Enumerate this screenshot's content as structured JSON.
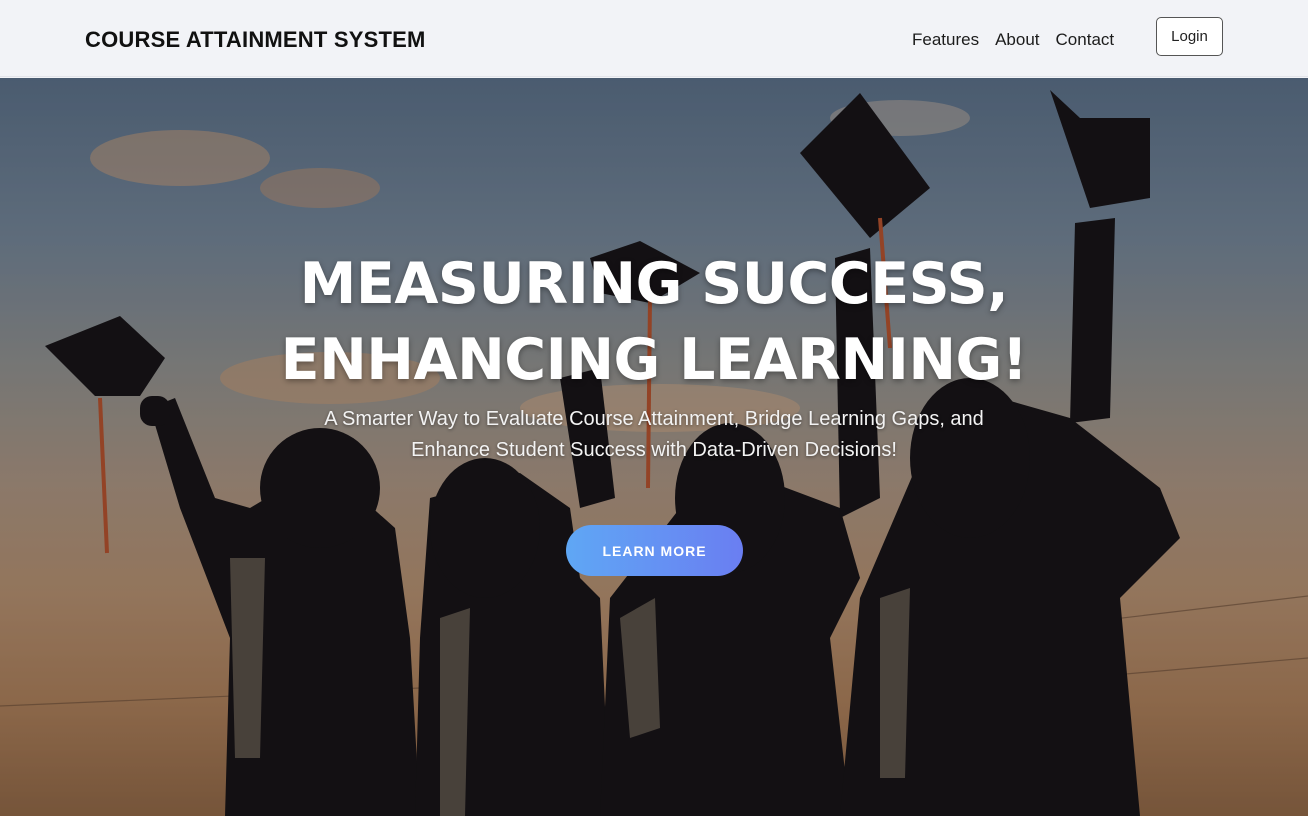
{
  "navbar": {
    "brand": "COURSE ATTAINMENT SYSTEM",
    "links": [
      "Features",
      "About",
      "Contact"
    ],
    "login_label": "Login"
  },
  "hero": {
    "headline_line1": "MEASURING SUCCESS,",
    "headline_line2": "ENHANCING LEARNING!",
    "subtext_line1": "A Smarter Way to Evaluate Course Attainment, Bridge Learning Gaps, and",
    "subtext_line2": "Enhance Student Success with Data-Driven Decisions!",
    "cta_label": "LEARN MORE",
    "background_image": "graduates-throwing-caps-at-sunset-photo"
  },
  "colors": {
    "nav_bg": "#f2f3f7",
    "brand_text": "#111111",
    "cta_gradient_start": "#5fa7f4",
    "cta_gradient_end": "#6a7ef2",
    "hero_text": "#ffffff"
  }
}
